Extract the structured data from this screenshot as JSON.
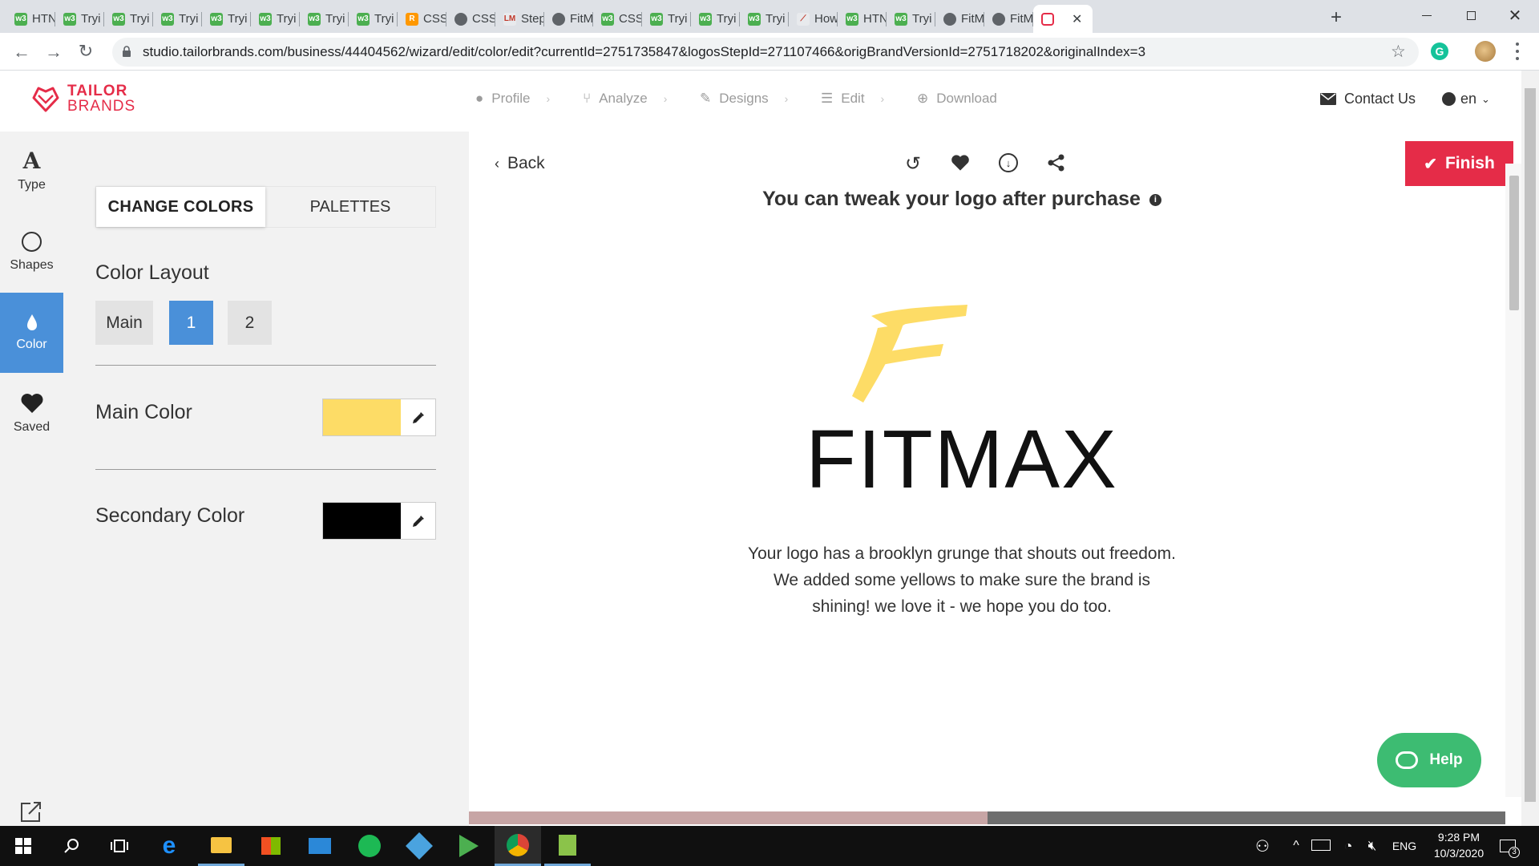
{
  "browser": {
    "tabs": [
      {
        "label": "HTN",
        "icon": "w3schools-icon"
      },
      {
        "label": "Tryi",
        "icon": "w3schools-icon"
      },
      {
        "label": "Tryi",
        "icon": "w3schools-icon"
      },
      {
        "label": "Tryi",
        "icon": "w3schools-icon"
      },
      {
        "label": "Tryi",
        "icon": "w3schools-icon"
      },
      {
        "label": "Tryi",
        "icon": "w3schools-icon"
      },
      {
        "label": "Tryi",
        "icon": "w3schools-icon"
      },
      {
        "label": "Tryi",
        "icon": "w3schools-icon"
      },
      {
        "label": "CSS",
        "icon": "r-icon"
      },
      {
        "label": "CSS",
        "icon": "globe-icon"
      },
      {
        "label": "Step",
        "icon": "lm-icon"
      },
      {
        "label": "FitM",
        "icon": "globe-icon"
      },
      {
        "label": "CSS",
        "icon": "w3schools-icon"
      },
      {
        "label": "Tryi",
        "icon": "w3schools-icon"
      },
      {
        "label": "Tryi",
        "icon": "w3schools-icon"
      },
      {
        "label": "Tryi",
        "icon": "w3schools-icon"
      },
      {
        "label": "How",
        "icon": "html-icon"
      },
      {
        "label": "HTN",
        "icon": "w3schools-icon"
      },
      {
        "label": "Tryi",
        "icon": "w3schools-icon"
      },
      {
        "label": "FitM",
        "icon": "globe-icon"
      },
      {
        "label": "FitM",
        "icon": "globe-icon"
      },
      {
        "label": "",
        "icon": "tailor-brands-icon"
      }
    ],
    "url": "studio.tailorbrands.com/business/44404562/wizard/edit/color/edit?currentId=2751735847&logosStepId=271107466&origBrandVersionId=2751718202&originalIndex=3"
  },
  "brand": {
    "line1": "TAILOR",
    "line2": "BRANDS"
  },
  "steps": [
    {
      "label": "Profile",
      "icon": "user-icon"
    },
    {
      "label": "Analyze",
      "icon": "analyze-icon"
    },
    {
      "label": "Designs",
      "icon": "pencil-icon"
    },
    {
      "label": "Edit",
      "icon": "sliders-icon"
    },
    {
      "label": "Download",
      "icon": "download-icon"
    }
  ],
  "header": {
    "contact": "Contact Us",
    "language": "en"
  },
  "rail": [
    {
      "label": "Type",
      "icon": "type-icon"
    },
    {
      "label": "Shapes",
      "icon": "circle-icon"
    },
    {
      "label": "Color",
      "icon": "drop-icon"
    },
    {
      "label": "Saved",
      "icon": "heart-icon"
    }
  ],
  "panel": {
    "tabs": [
      "CHANGE COLORS",
      "PALETTES"
    ],
    "layout_title": "Color Layout",
    "layout_options": [
      "Main",
      "1",
      "2"
    ],
    "main_color": {
      "label": "Main Color",
      "value": "#fddc66"
    },
    "secondary_color": {
      "label": "Secondary Color",
      "value": "#000000"
    }
  },
  "canvas": {
    "back": "Back",
    "finish": "Finish",
    "notice": "You can tweak your logo after purchase",
    "logo_text": "FITMAX",
    "description": [
      "Your logo has a brooklyn grunge that shouts out freedom.",
      "We added some yellows to make sure the brand is",
      "shining! we love it - we hope you do too."
    ],
    "help": "Help"
  },
  "colors": {
    "accent": "#e52c48",
    "active": "#4a90d9",
    "help": "#3dbc72",
    "logo_yellow": "#fddc66"
  },
  "taskbar": {
    "time": "9:28 PM",
    "date": "10/3/2020",
    "lang": "ENG",
    "notifications": "3"
  }
}
